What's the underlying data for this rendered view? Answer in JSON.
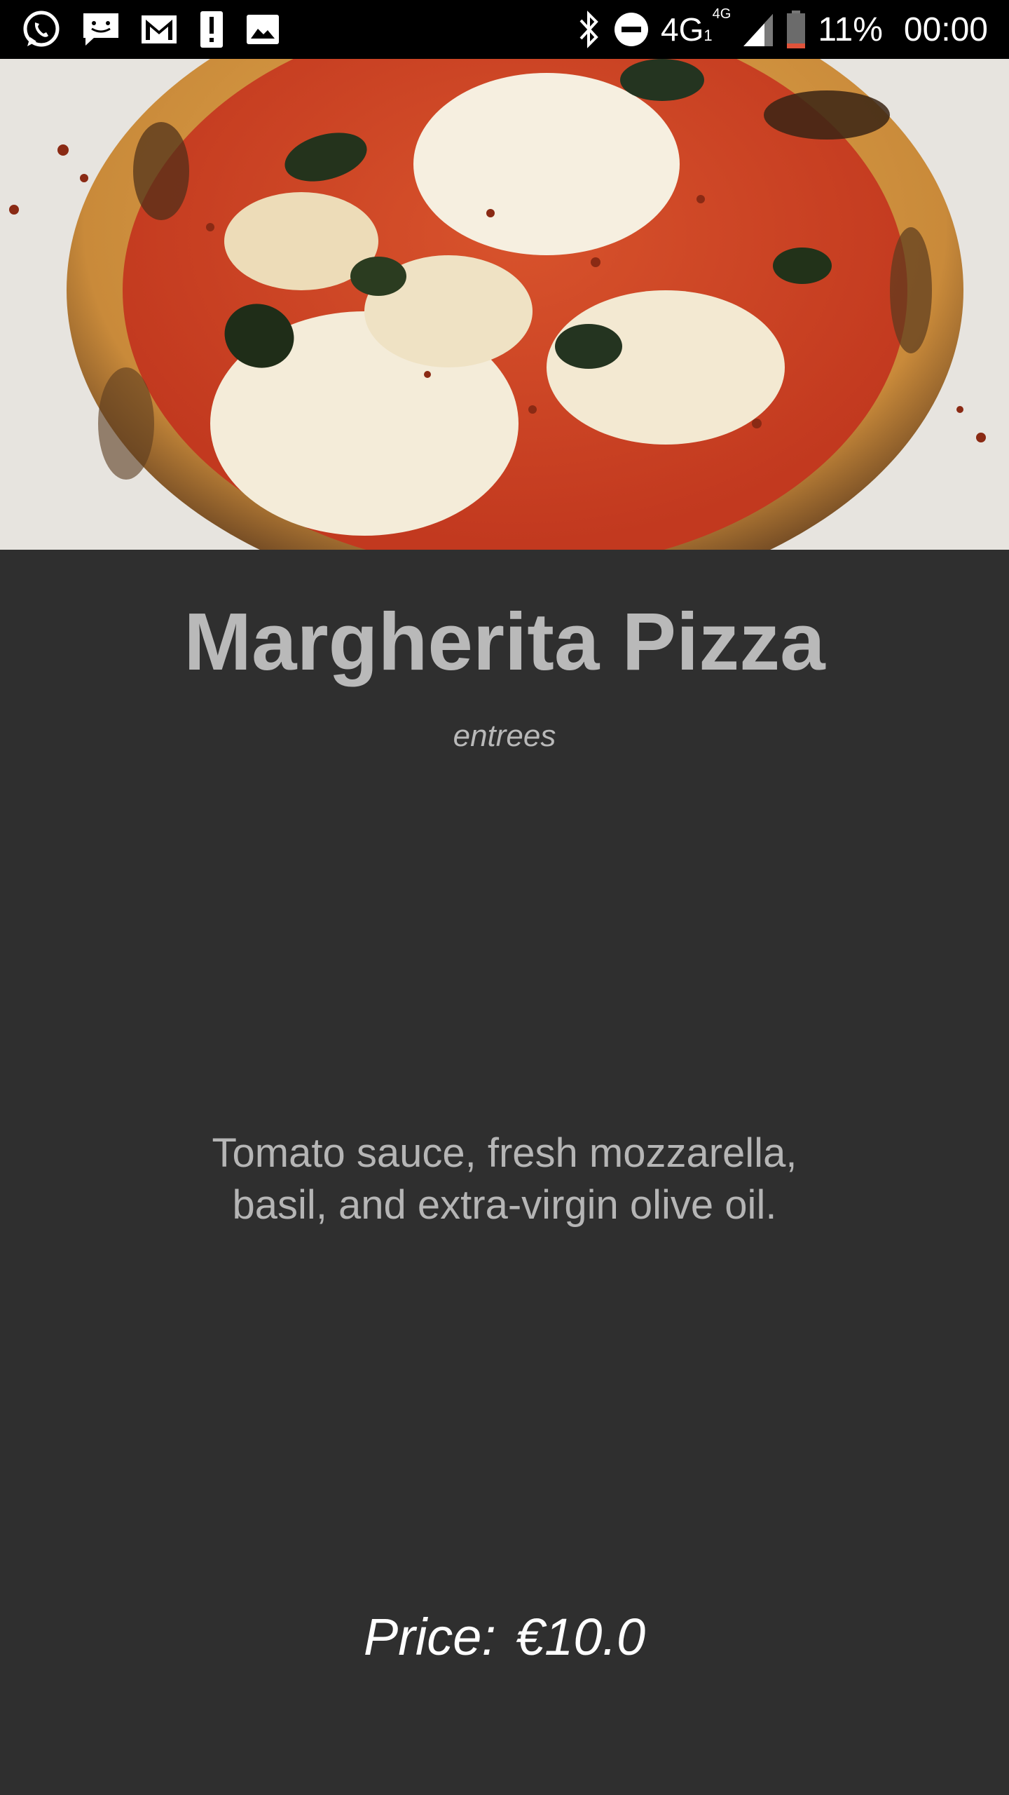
{
  "status_bar": {
    "left_icons": [
      "whatsapp-icon",
      "messages-icon",
      "gmail-icon",
      "alert-icon",
      "gallery-icon"
    ],
    "right_icons": [
      "bluetooth-icon",
      "do-not-disturb-icon",
      "signal-icon",
      "battery-icon"
    ],
    "network": "4G",
    "network_sub": "1",
    "network_sup": "4G",
    "battery": "11%",
    "time": "00:00"
  },
  "hero": {
    "image": "margherita-pizza-photo"
  },
  "dish": {
    "name": "Margherita Pizza",
    "category": "entrees",
    "description": "Tomato sauce, fresh mozzarella, basil, and extra-virgin olive oil.",
    "price_label": "Price:",
    "price_value": "€10.0"
  },
  "colors": {
    "background": "#2f2f2f",
    "status_bar": "#000000",
    "title_text": "#b9b9b9",
    "price_text": "#ffffff",
    "battery_low": "#e0533a"
  }
}
